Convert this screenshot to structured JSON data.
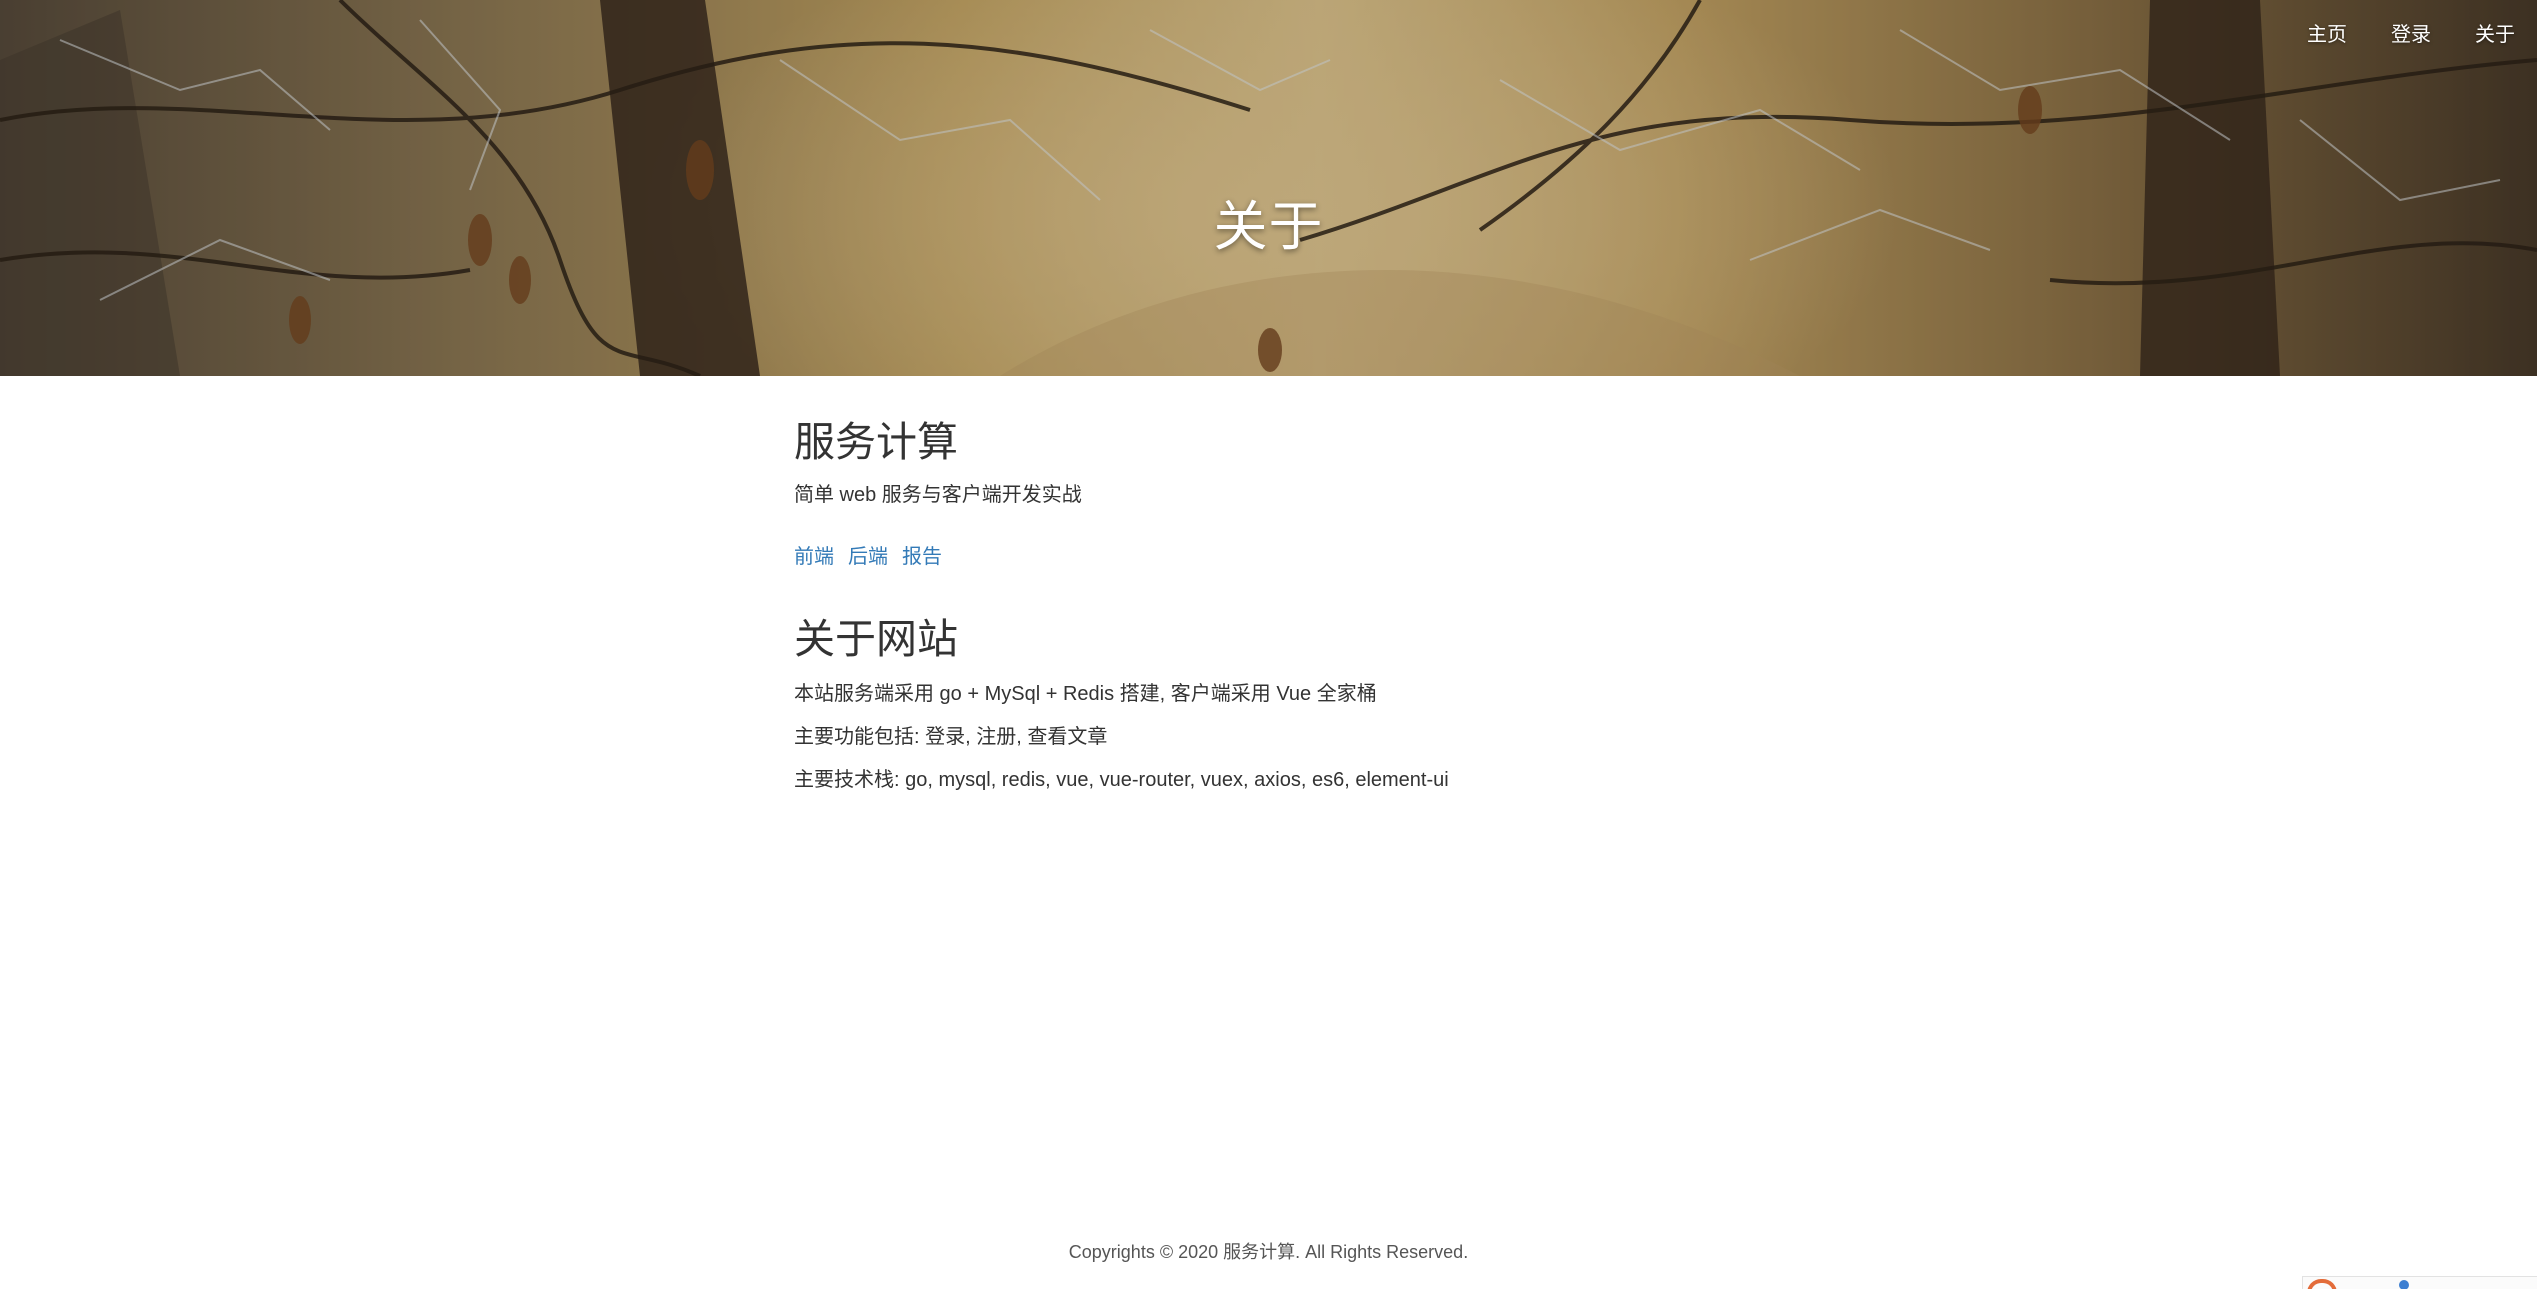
{
  "nav": {
    "items": [
      {
        "label": "主页"
      },
      {
        "label": "登录"
      },
      {
        "label": "关于"
      }
    ]
  },
  "hero": {
    "title": "关于"
  },
  "course": {
    "title": "服务计算",
    "subtitle": "简单 web 服务与客户端开发实战",
    "links": [
      {
        "label": "前端"
      },
      {
        "label": "后端"
      },
      {
        "label": "报告"
      }
    ]
  },
  "about": {
    "title": "关于网站",
    "lines": [
      "本站服务端采用 go + MySql + Redis 搭建, 客户端采用 Vue 全家桶",
      "主要功能包括: 登录, 注册, 查看文章",
      "主要技术栈: go, mysql, redis, vue, vue-router, vuex, axios, es6, element-ui"
    ]
  },
  "footer": {
    "copyright": "Copyrights © 2020 服务计算. All Rights Reserved."
  },
  "colors": {
    "link": "#337ab7",
    "text": "#333333",
    "hero_overlay_text": "#ffffff"
  }
}
